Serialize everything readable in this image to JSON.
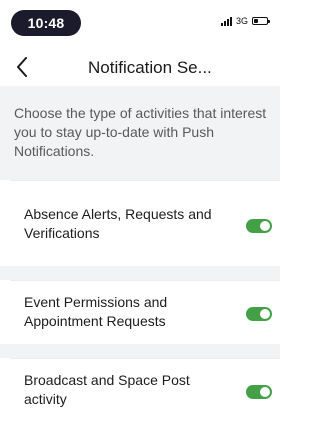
{
  "status_bar": {
    "time": "10:48",
    "network": "3G",
    "signal_icon": "signal-bars-icon",
    "battery_icon": "battery-icon",
    "battery_level": 0.35
  },
  "nav": {
    "back_icon": "chevron-left-icon",
    "title": "Notification Se..."
  },
  "intro": {
    "text": "Choose the type of activities that interest you to stay up-to-date with Push Notifications."
  },
  "settings": [
    {
      "label": "Absence Alerts, Requests and Verifications",
      "enabled": true
    },
    {
      "label": "Event Permissions and Appointment Requests",
      "enabled": true
    },
    {
      "label": "Broadcast and Space Post activity",
      "enabled": true
    }
  ],
  "colors": {
    "toggle_on": "#43a047",
    "background_gray": "#f2f3f5"
  }
}
